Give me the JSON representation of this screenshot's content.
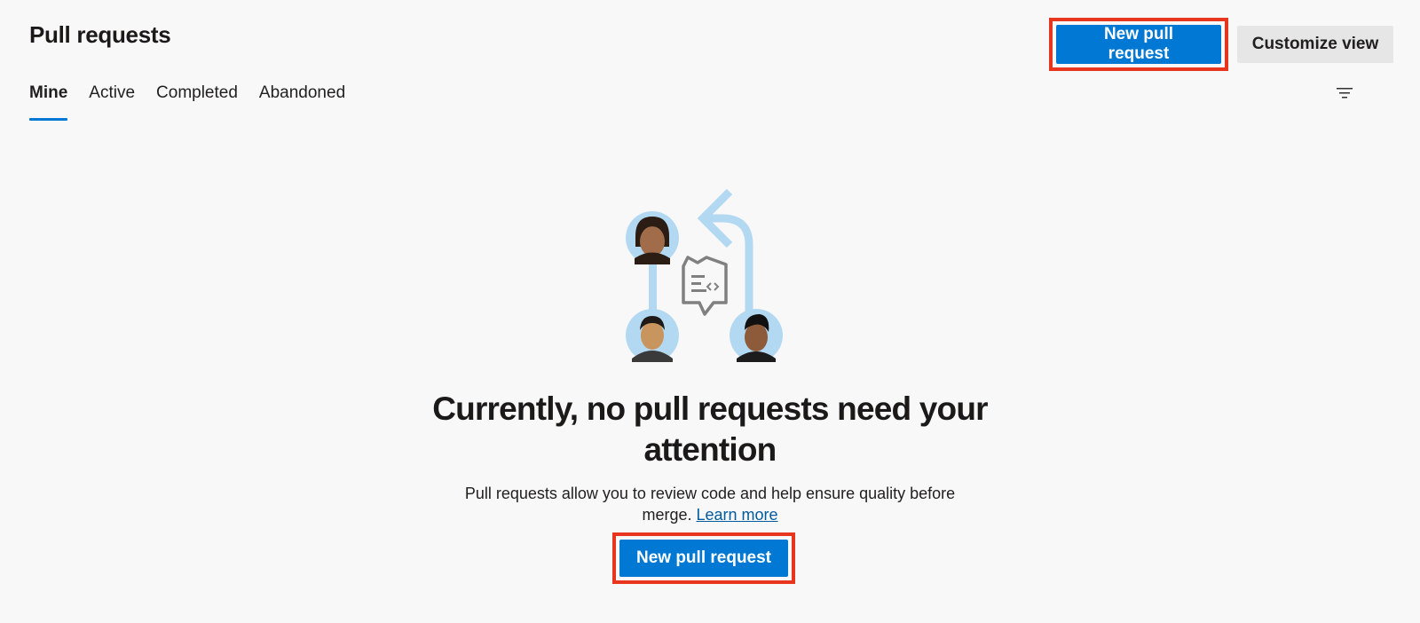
{
  "header": {
    "title": "Pull requests",
    "new_pr_label": "New pull request",
    "customize_label": "Customize view"
  },
  "tabs": [
    {
      "label": "Mine",
      "active": true
    },
    {
      "label": "Active",
      "active": false
    },
    {
      "label": "Completed",
      "active": false
    },
    {
      "label": "Abandoned",
      "active": false
    }
  ],
  "filter": {
    "icon": "filter-icon"
  },
  "empty_state": {
    "title_line1": "Currently, no pull requests need your",
    "title_line2": "attention",
    "desc_line1": "Pull requests allow you to review code and help ensure quality before",
    "desc_line2_prefix": "merge. ",
    "learn_more": "Learn more",
    "button_label": "New pull request",
    "illustration_icon": "pull-request-people-illustration"
  },
  "colors": {
    "accent": "#0078d4",
    "highlight": "#e8351d",
    "background": "#f8f8f8",
    "illustration_blue": "#b3d9f2"
  }
}
